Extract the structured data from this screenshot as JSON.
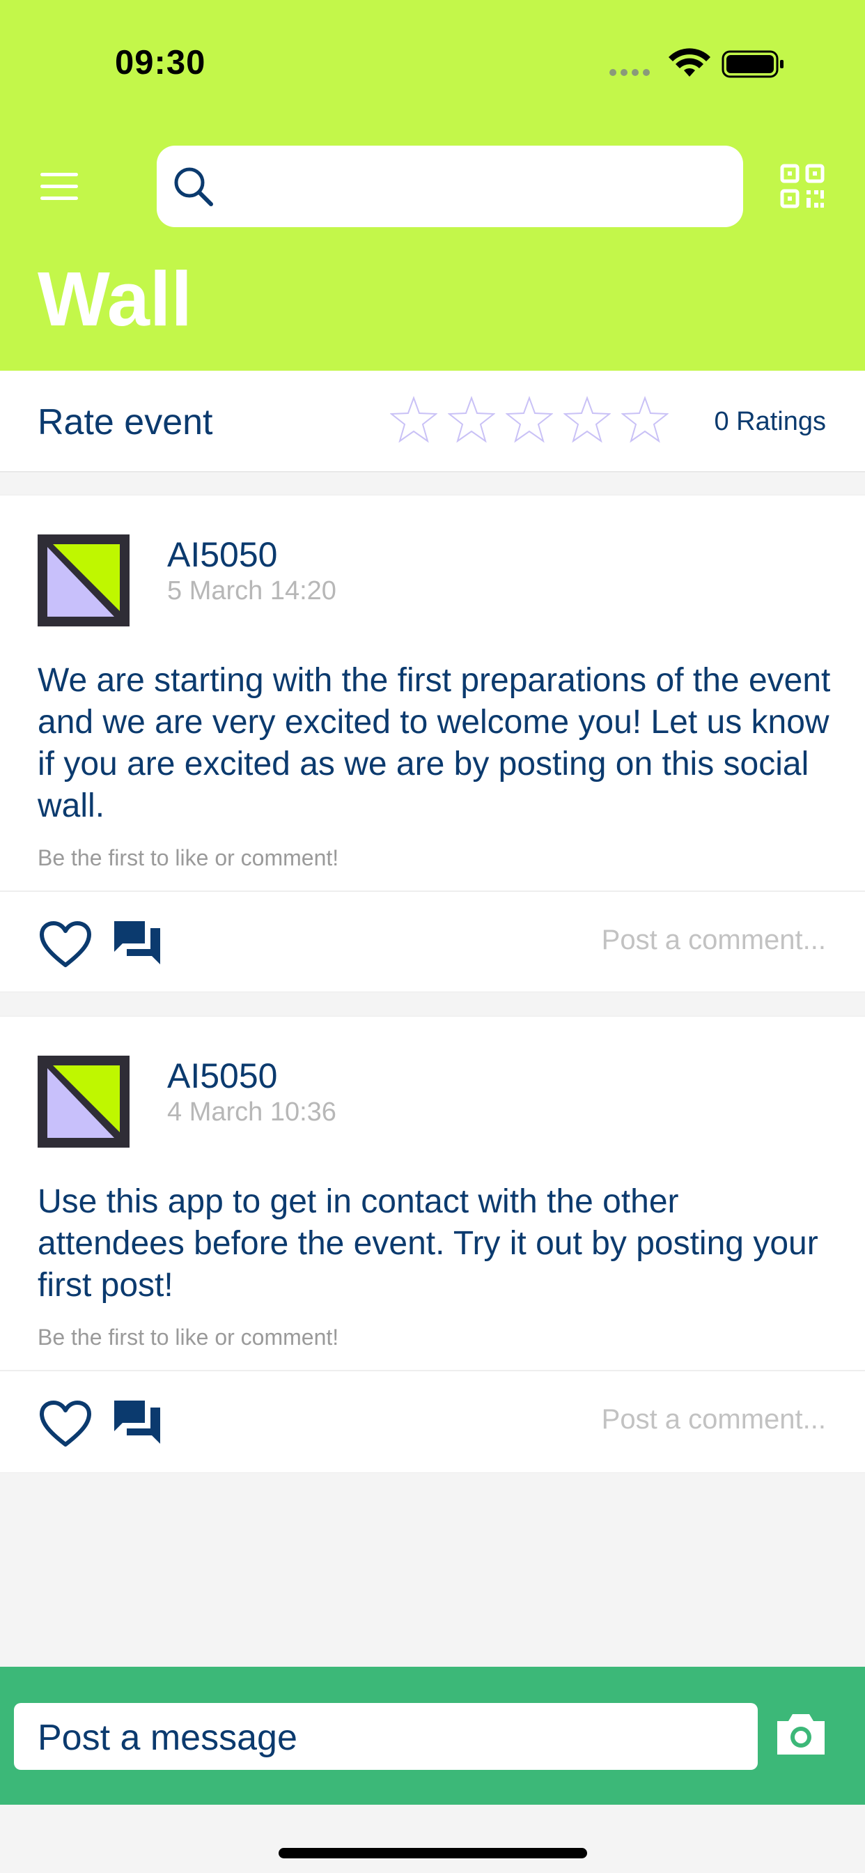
{
  "status_bar": {
    "time": "09:30"
  },
  "header": {
    "title": "Wall",
    "search_placeholder": "",
    "menu_icon": "hamburger-icon",
    "search_icon": "search-icon",
    "qr_icon": "qr-code-icon",
    "background_color": "#c3f74a"
  },
  "rating": {
    "label": "Rate event",
    "stars_filled": 0,
    "stars_total": 5,
    "count_text": "0 Ratings"
  },
  "posts": [
    {
      "author": "AI5050",
      "date": "5 March 14:20",
      "text": "We are starting with the first preparations of the event and we are very excited to welcome you! Let us know if you are excited as we are by posting on this social wall.",
      "hint": "Be the first to like or comment!",
      "comment_placeholder": "Post a comment..."
    },
    {
      "author": "AI5050",
      "date": "4 March 10:36",
      "text": "Use this app to get in contact with the other attendees before the event. Try it out by posting your first post!",
      "hint": "Be the first to like or comment!",
      "comment_placeholder": "Post a comment..."
    }
  ],
  "composer": {
    "placeholder": "Post a message",
    "camera_icon": "camera-icon",
    "background_color": "#3cb878"
  },
  "colors": {
    "accent": "#c3f74a",
    "text": "#0b3a6e",
    "avatar_purple": "#c8c0fb",
    "avatar_green": "#bff700",
    "green": "#3cb878"
  }
}
